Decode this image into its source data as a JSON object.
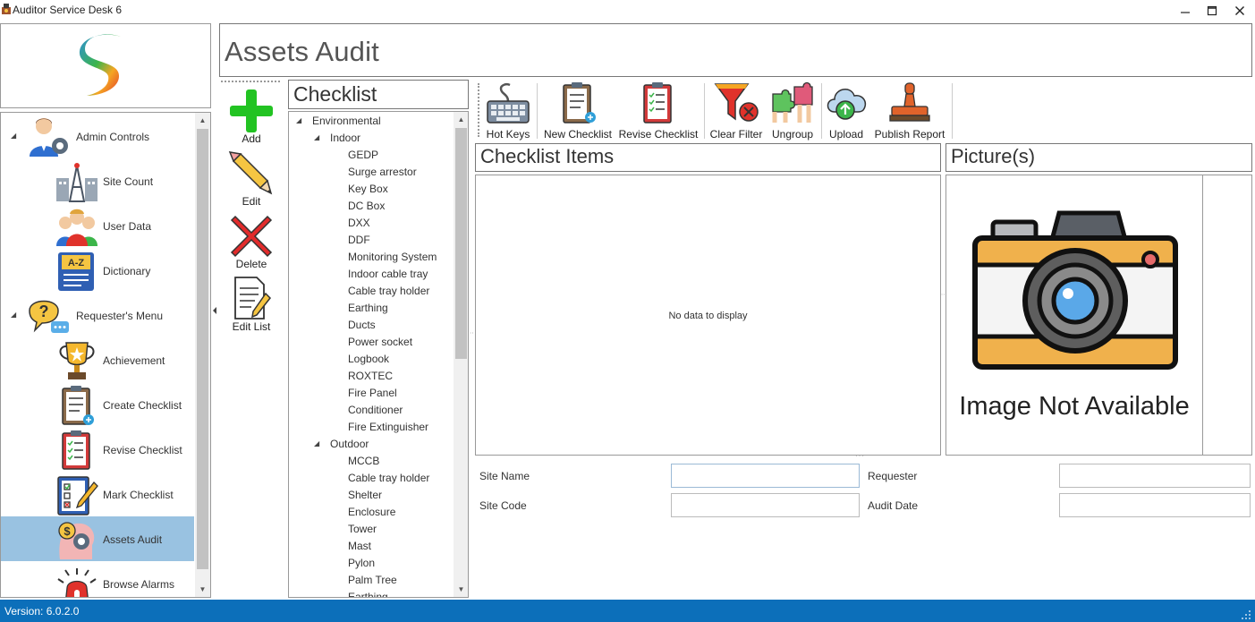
{
  "window": {
    "title": "Auditor Service Desk 6",
    "minimize": "—",
    "maximize": "☐",
    "close": "✕"
  },
  "nav": {
    "groups": [
      {
        "label": "Admin Controls",
        "items": [
          "Site Count",
          "User Data",
          "Dictionary"
        ]
      },
      {
        "label": "Requester's Menu",
        "items": [
          "Achievement",
          "Create Checklist",
          "Revise Checklist",
          "Mark Checklist",
          "Assets Audit",
          "Browse Alarms"
        ]
      }
    ],
    "selected": "Assets Audit"
  },
  "header": {
    "title": "Assets Audit"
  },
  "actions": {
    "add": "Add",
    "edit": "Edit",
    "delete": "Delete",
    "edit_list": "Edit List"
  },
  "checklist": {
    "title": "Checklist",
    "root": "Environmental",
    "indoor": {
      "label": "Indoor",
      "items": [
        "GEDP",
        "Surge arrestor",
        "Key Box",
        "DC Box",
        "DXX",
        "DDF",
        "Monitoring System",
        "Indoor cable tray",
        "Cable tray holder",
        "Earthing",
        "Ducts",
        "Power socket",
        "Logbook",
        "ROXTEC",
        "Fire Panel",
        "Conditioner",
        "Fire Extinguisher"
      ]
    },
    "outdoor": {
      "label": "Outdoor",
      "items": [
        "MCCB",
        "Cable tray holder",
        "Shelter",
        "Enclosure",
        "Tower",
        "Mast",
        "Pylon",
        "Palm Tree",
        "Earthing"
      ]
    }
  },
  "toolbar": {
    "hot_keys": "Hot Keys",
    "new_checklist": "New Checklist",
    "revise_checklist": "Revise Checklist",
    "clear_filter": "Clear Filter",
    "ungroup": "Ungroup",
    "upload": "Upload",
    "publish_report": "Publish Report"
  },
  "items_panel": {
    "title": "Checklist Items",
    "empty_text": "No data to display"
  },
  "picture_panel": {
    "title": "Picture(s)",
    "placeholder_text": "Image Not Available"
  },
  "form": {
    "site_name_label": "Site Name",
    "site_name_value": "",
    "site_code_label": "Site Code",
    "site_code_value": "",
    "requester_label": "Requester",
    "requester_value": "",
    "audit_date_label": "Audit Date",
    "audit_date_value": ""
  },
  "status": {
    "version": "Version: 6.0.2.0"
  },
  "colors": {
    "selected_nav": "#99c2e1",
    "statusbar": "#0c6fba",
    "add_green": "#22c322",
    "delete_red": "#e22b2b"
  }
}
